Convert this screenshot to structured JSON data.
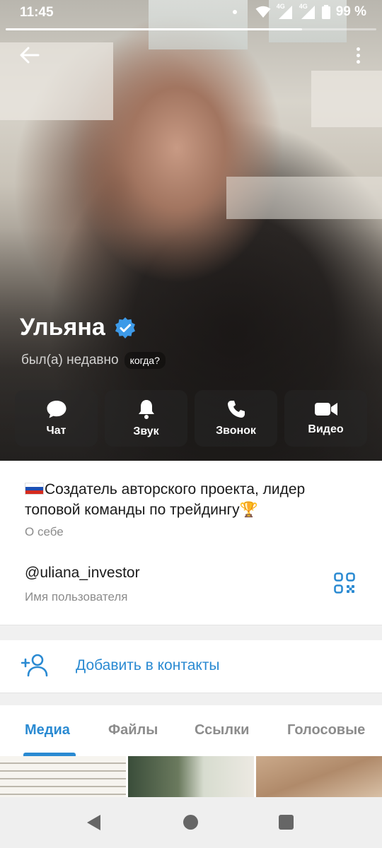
{
  "status_bar": {
    "time": "11:45",
    "network_1": "4G",
    "network_2": "4G",
    "battery": "99 %"
  },
  "profile": {
    "name": "Ульяна",
    "verified": true,
    "last_seen": "был(а) недавно",
    "when_badge": "когда?",
    "photo_progress": 0.8
  },
  "actions": [
    {
      "label": "Чат",
      "icon": "chat-bubble-icon"
    },
    {
      "label": "Звук",
      "icon": "bell-icon"
    },
    {
      "label": "Звонок",
      "icon": "phone-icon"
    },
    {
      "label": "Видео",
      "icon": "video-camera-icon"
    }
  ],
  "info": {
    "bio": "Создатель авторского проекта, лидер топовой команды по трейдингу🏆",
    "bio_label": "О себе",
    "username": "@uliana_investor",
    "username_label": "Имя пользователя"
  },
  "add_contact": {
    "label": "Добавить в контакты"
  },
  "tabs": [
    {
      "label": "Медиа",
      "active": true
    },
    {
      "label": "Файлы",
      "active": false
    },
    {
      "label": "Ссылки",
      "active": false
    },
    {
      "label": "Голосовые",
      "active": false
    }
  ],
  "colors": {
    "accent": "#2a8ad2",
    "verified": "#3d9ae8"
  }
}
